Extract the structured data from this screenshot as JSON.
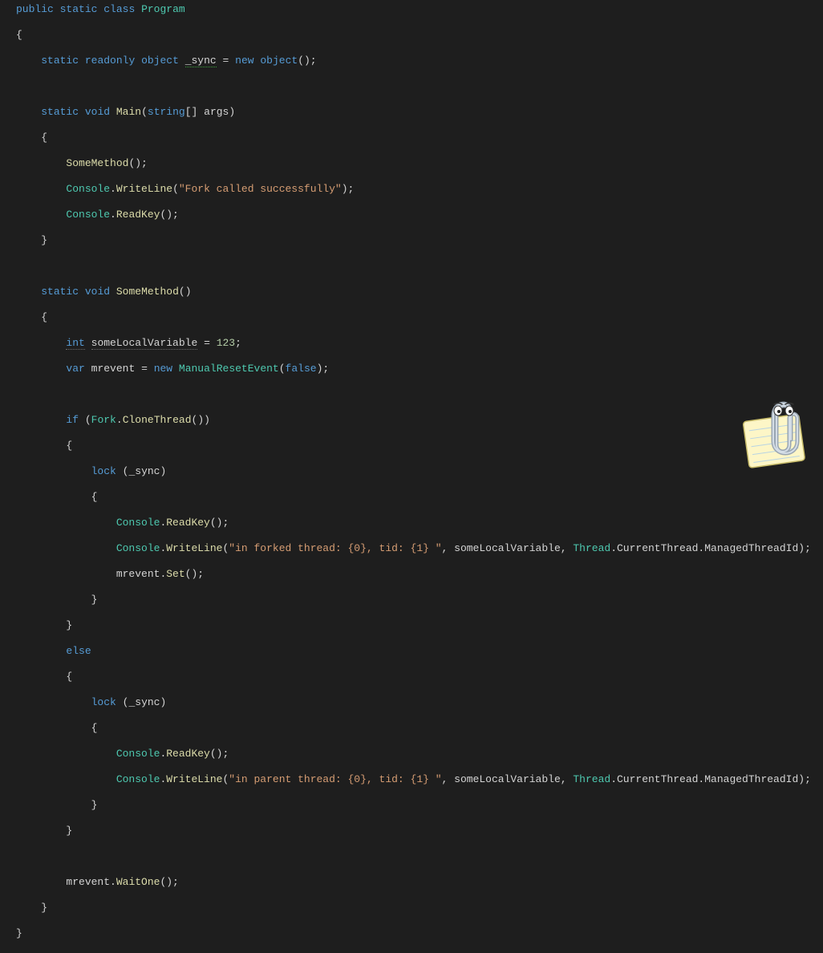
{
  "code": {
    "l1": {
      "kw_public": "public",
      "kw_static": "static",
      "kw_class": "class",
      "name": "Program"
    },
    "l2": "{",
    "l3": {
      "kw_static": "static",
      "kw_readonly": "readonly",
      "kw_object": "object",
      "field": "_sync",
      "eq": "=",
      "kw_new": "new",
      "kw_object2": "object",
      "tail": "();"
    },
    "l5": {
      "kw_static": "static",
      "kw_void": "void",
      "method": "Main",
      "paren_o": "(",
      "kw_string": "string",
      "br": "[]",
      "param": "args",
      "paren_c": ")"
    },
    "l6": "{",
    "l7": {
      "call": "SomeMethod",
      "tail": "();"
    },
    "l8": {
      "cls": "Console",
      "dot": ".",
      "method": "WriteLine",
      "p1": "(",
      "str": "\"Fork called successfully\"",
      "p2": ");"
    },
    "l9": {
      "cls": "Console",
      "dot": ".",
      "method": "ReadKey",
      "tail": "();"
    },
    "l10": "}",
    "l12": {
      "kw_static": "static",
      "kw_void": "void",
      "method": "SomeMethod",
      "tail": "()"
    },
    "l13": "{",
    "l14": {
      "kw_int": "int",
      "var": "someLocalVariable",
      "eq": "=",
      "num": "123",
      "tail": ";"
    },
    "l15": {
      "kw_var": "var",
      "var": "mrevent",
      "eq": "=",
      "kw_new": "new",
      "type": "ManualResetEvent",
      "p1": "(",
      "bool": "false",
      "p2": ");"
    },
    "l17": {
      "kw_if": "if",
      "p1": "(",
      "cls": "Fork",
      "dot": ".",
      "method": "CloneThread",
      "p2": "())"
    },
    "l18": "{",
    "l19": {
      "kw_lock": "lock",
      "p1": "(",
      "var": "_sync",
      "p2": ")"
    },
    "l20": "{",
    "l21": {
      "cls": "Console",
      "dot": ".",
      "method": "ReadKey",
      "tail": "();"
    },
    "l22": {
      "cls": "Console",
      "dot": ".",
      "method": "WriteLine",
      "p1": "(",
      "str": "\"in forked thread: {0}, tid: {1} \"",
      "c1": ", ",
      "arg1": "someLocalVariable",
      "c2": ", ",
      "cls2": "Thread",
      "dot2": ".",
      "prop": "CurrentThread",
      "dot3": ".",
      "prop2": "ManagedThreadId",
      "p2": ");"
    },
    "l23": {
      "var": "mrevent",
      "dot": ".",
      "method": "Set",
      "tail": "();"
    },
    "l24": "}",
    "l25": "}",
    "l26": {
      "kw_else": "else"
    },
    "l27": "{",
    "l28": {
      "kw_lock": "lock",
      "p1": "(",
      "var": "_sync",
      "p2": ")"
    },
    "l29": "{",
    "l30": {
      "cls": "Console",
      "dot": ".",
      "method": "ReadKey",
      "tail": "();"
    },
    "l31": {
      "cls": "Console",
      "dot": ".",
      "method": "WriteLine",
      "p1": "(",
      "str": "\"in parent thread: {0}, tid: {1} \"",
      "c1": ", ",
      "arg1": "someLocalVariable",
      "c2": ", ",
      "cls2": "Thread",
      "dot2": ".",
      "prop": "CurrentThread",
      "dot3": ".",
      "prop2": "ManagedThreadId",
      "p2": ");"
    },
    "l32": "}",
    "l33": "}",
    "l35": {
      "var": "mrevent",
      "dot": ".",
      "method": "WaitOne",
      "tail": "();"
    },
    "l36": "}",
    "l37": "}"
  },
  "assistant": {
    "name": "clippy"
  }
}
